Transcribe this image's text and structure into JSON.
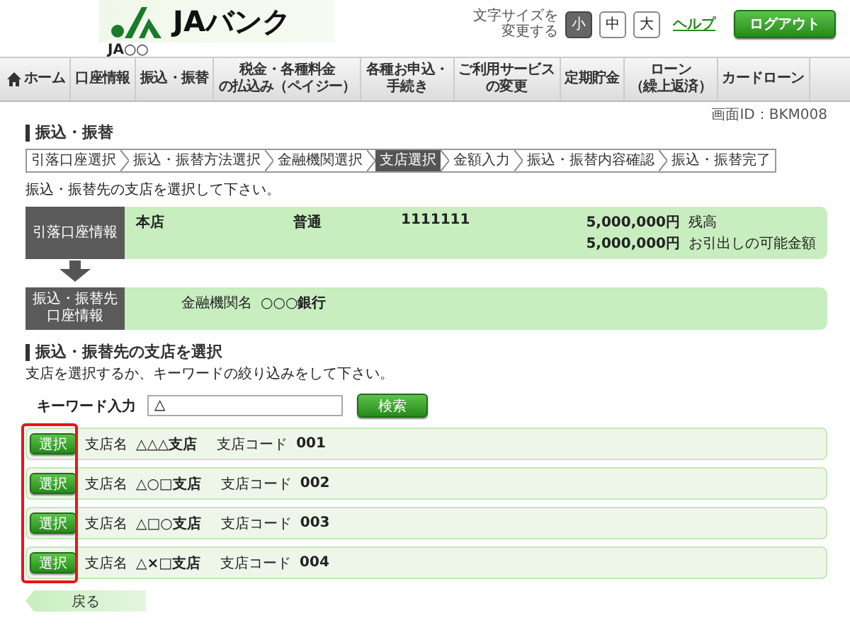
{
  "header": {
    "bank_name": "JAバンク",
    "branch_label": "JA○○",
    "font_size": {
      "label": "文字サイズを変更する",
      "options": [
        {
          "label": "小",
          "selected": true
        },
        {
          "label": "中",
          "selected": false
        },
        {
          "label": "大",
          "selected": false
        }
      ]
    },
    "help_link": "ヘルプ",
    "logout_button": "ログアウト"
  },
  "nav": [
    {
      "kind": "home",
      "lines": [
        "ホーム"
      ]
    },
    {
      "kind": "plain",
      "lines": [
        "口座情報"
      ]
    },
    {
      "kind": "plain",
      "lines": [
        "振込・振替"
      ]
    },
    {
      "kind": "plain",
      "lines": [
        "税金・各種料金",
        "の払込み（ペイジー）"
      ]
    },
    {
      "kind": "plain",
      "lines": [
        "各種お申込・",
        "手続き"
      ]
    },
    {
      "kind": "plain",
      "lines": [
        "ご利用サービス",
        "の変更"
      ]
    },
    {
      "kind": "plain",
      "lines": [
        "定期貯金"
      ]
    },
    {
      "kind": "plain",
      "lines": [
        "ローン",
        "（繰上返済）"
      ]
    },
    {
      "kind": "plain",
      "lines": [
        "カードローン"
      ]
    }
  ],
  "screen_id": "画面ID：BKM008",
  "page_title": "振込・振替",
  "steps": [
    {
      "label": "引落口座選択",
      "selected": false
    },
    {
      "label": "振込・振替方法選択",
      "selected": false
    },
    {
      "label": "金融機関選択",
      "selected": false
    },
    {
      "label": "支店選択",
      "selected": true
    },
    {
      "label": "金額入力",
      "selected": false
    },
    {
      "label": "振込・振替内容確認",
      "selected": false
    },
    {
      "label": "振込・振替完了",
      "selected": false
    }
  ],
  "instruction": "振込・振替先の支店を選択して下さい。",
  "source_account": {
    "label": "引落口座情報",
    "branch": "本店",
    "type": "普通",
    "number": "1111111",
    "balance": "5,000,000円",
    "balance_label": "残高",
    "available": "5,000,000円",
    "available_label": "お引出しの可能金額"
  },
  "destination": {
    "label": "振込・振替先口座情報",
    "bank_label": "金融機関名",
    "bank_name": "○○○銀行"
  },
  "branch_section": {
    "title": "振込・振替先の支店を選択",
    "hint": "支店を選択するか、キーワードの絞り込みをして下さい。",
    "keyword_label": "キーワード入力",
    "keyword_value": "△",
    "search_button": "検索",
    "highlight_select_buttons": true,
    "branches": [
      {
        "select_button": "選択",
        "name_label": "支店名",
        "name": "△△△支店",
        "code_label": "支店コード",
        "code": "001"
      },
      {
        "select_button": "選択",
        "name_label": "支店名",
        "name": "△○□支店",
        "code_label": "支店コード",
        "code": "002"
      },
      {
        "select_button": "選択",
        "name_label": "支店名",
        "name": "△□○支店",
        "code_label": "支店コード",
        "code": "003"
      },
      {
        "select_button": "選択",
        "name_label": "支店名",
        "name": "△×□支店",
        "code_label": "支店コード",
        "code": "004"
      }
    ]
  },
  "back_button": "戻る"
}
